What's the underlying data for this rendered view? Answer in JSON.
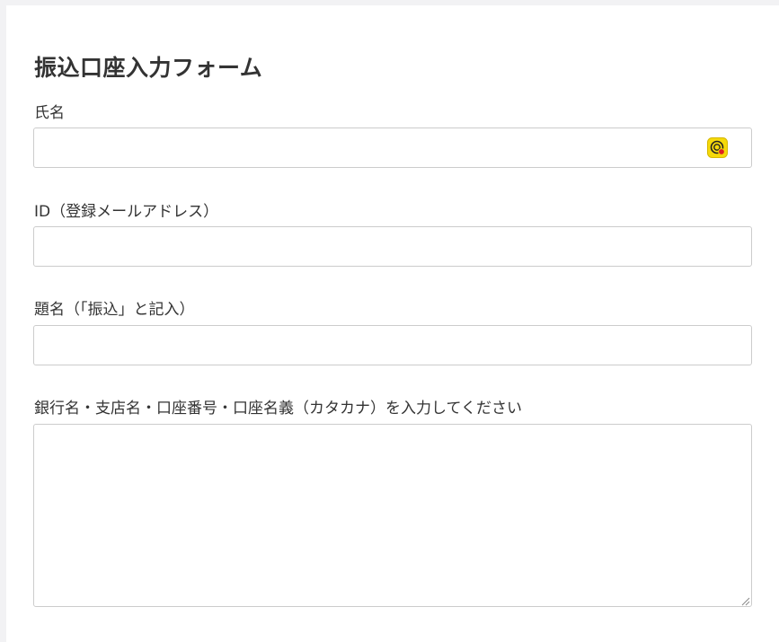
{
  "form": {
    "title": "振込口座入力フォーム",
    "fields": [
      {
        "label": "氏名",
        "value": ""
      },
      {
        "label": "ID（登録メールアドレス）",
        "value": ""
      },
      {
        "label": "題名（「振込」と記入）",
        "value": ""
      },
      {
        "label": "銀行名・支店名・口座番号・口座名義（カタカナ）を入力してください",
        "value": ""
      }
    ],
    "autofill_icon": "password-manager-icon"
  },
  "colors": {
    "page_bg": "#f2f2f4",
    "card_bg": "#ffffff",
    "border": "#cccccc",
    "text": "#333333",
    "icon_yellow": "#f5d90a",
    "icon_red": "#e02020"
  }
}
